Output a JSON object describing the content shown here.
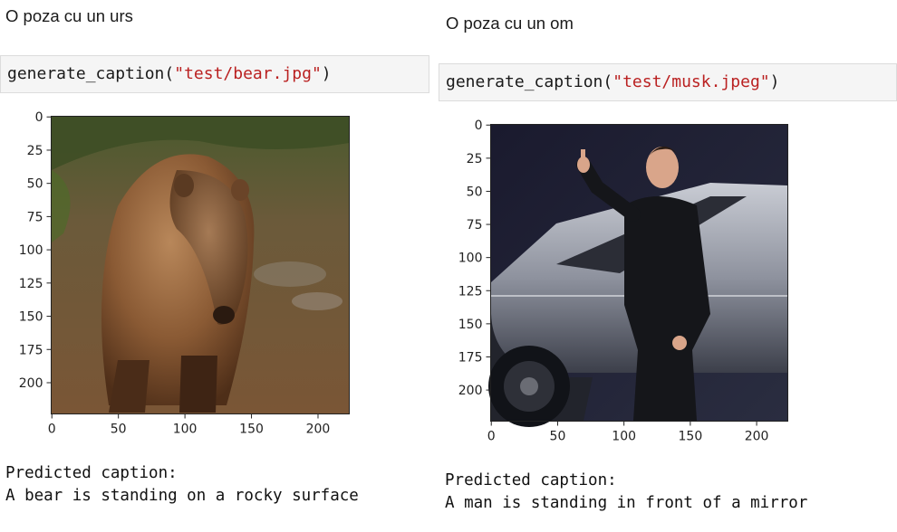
{
  "left": {
    "heading": "O poza cu un urs",
    "code": {
      "fn": "generate_caption(",
      "arg": "\"test/bear.jpg\"",
      "close": ")"
    },
    "plot": {
      "y_ticks": [
        "0",
        "25",
        "50",
        "75",
        "100",
        "125",
        "150",
        "175",
        "200"
      ],
      "x_ticks": [
        "0",
        "50",
        "100",
        "150",
        "200"
      ],
      "image_alt": "brown bear standing on rocky ground in a forest"
    },
    "output": {
      "line1": "Predicted caption:",
      "line2": "A bear is standing on a rocky surface"
    }
  },
  "right": {
    "heading": "O poza cu un om",
    "code": {
      "fn": "generate_caption(",
      "arg": "\"test/musk.jpeg\"",
      "close": ")"
    },
    "plot": {
      "y_ticks": [
        "0",
        "25",
        "50",
        "75",
        "100",
        "125",
        "150",
        "175",
        "200"
      ],
      "x_ticks": [
        "0",
        "50",
        "100",
        "150",
        "200"
      ],
      "image_alt": "man in black jacket pointing up in front of an angular silver truck"
    },
    "output": {
      "line1": "Predicted caption:",
      "line2": "A man is standing in front of a mirror"
    }
  }
}
